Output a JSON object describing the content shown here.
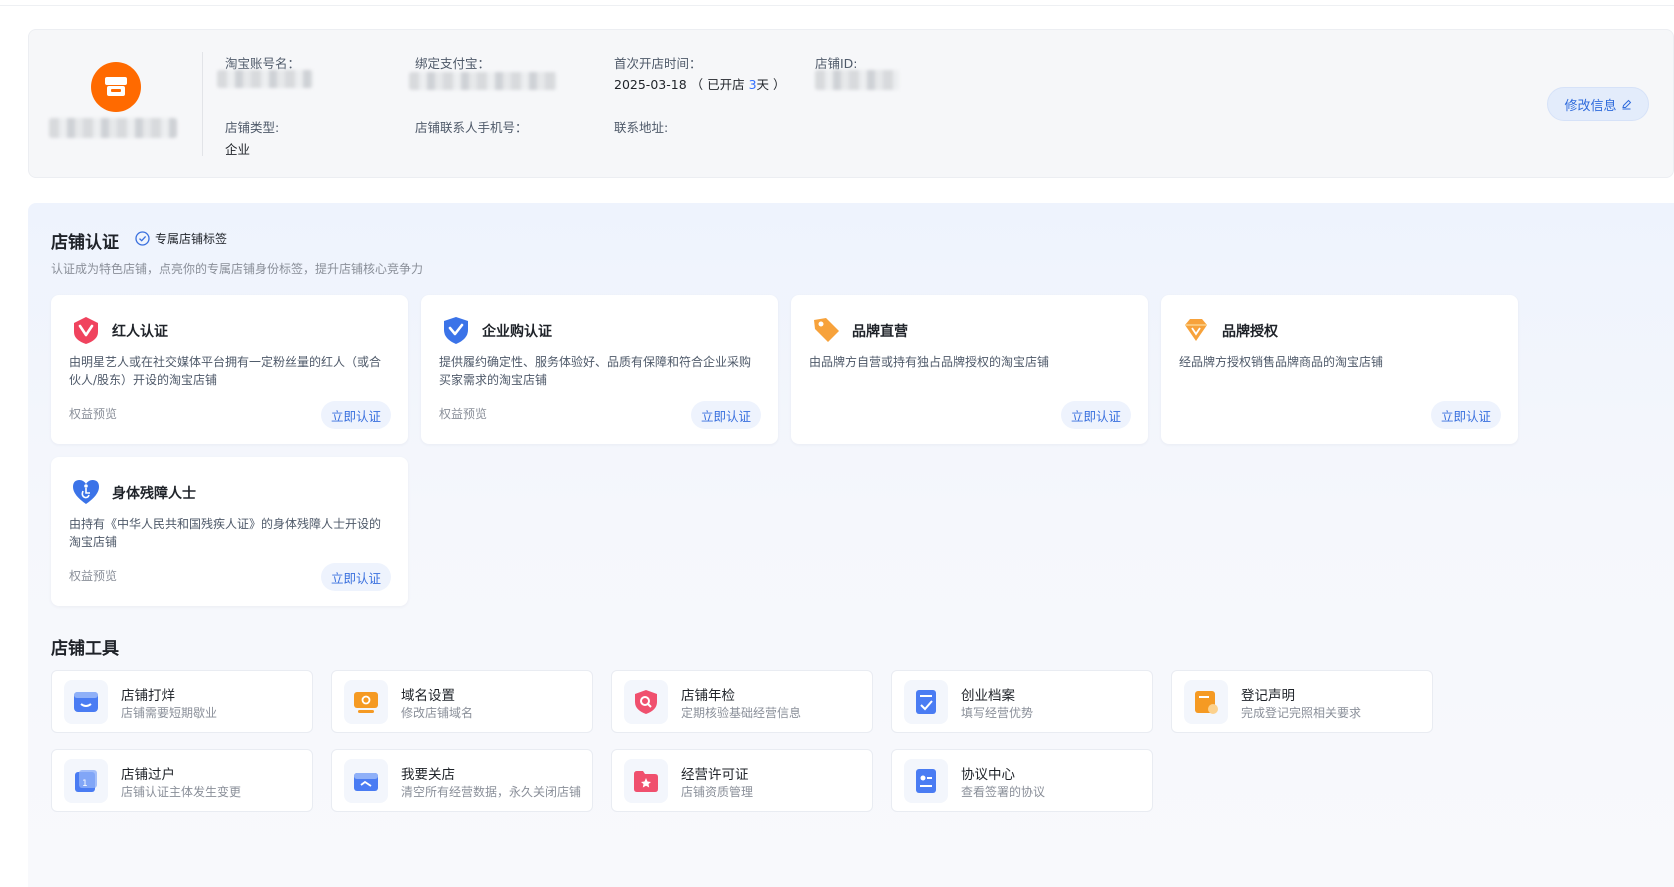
{
  "profile": {
    "account_label": "淘宝账号名：",
    "alipay_label": "绑定支付宝：",
    "open_time_label": "首次开店时间：",
    "open_date": "2025-03-18",
    "open_days_prefix": "（ 已开店 ",
    "open_days": "3",
    "open_days_suffix": "天 ）",
    "shop_id_label": "店铺ID:",
    "shop_type_label": "店铺类型:",
    "shop_type": "企业",
    "phone_label": "店铺联系人手机号：",
    "address_label": "联系地址:",
    "edit_button": "修改信息"
  },
  "certification": {
    "title": "店铺认证",
    "tag": "专属店铺标签",
    "subtitle": "认证成为特色店铺，点亮你的专属店铺身份标签，提升店铺核心竞争力",
    "cards": [
      {
        "title": "红人认证",
        "icon": "red-heart-badge-icon",
        "desc": "由明星艺人或在社交媒体平台拥有一定粉丝量的红人（或合伙人/股东）开设的淘宝店铺",
        "preview": "权益预览",
        "button": "立即认证"
      },
      {
        "title": "企业购认证",
        "icon": "blue-shield-check-icon",
        "desc": "提供履约确定性、服务体验好、品质有保障和符合企业采购买家需求的淘宝店铺",
        "preview": "权益预览",
        "button": "立即认证"
      },
      {
        "title": "品牌直营",
        "icon": "orange-tag-icon",
        "desc": "由品牌方自营或持有独占品牌授权的淘宝店铺",
        "preview": "",
        "button": "立即认证"
      },
      {
        "title": "品牌授权",
        "icon": "orange-diamond-icon",
        "desc": "经品牌方授权销售品牌商品的淘宝店铺",
        "preview": "",
        "button": "立即认证"
      },
      {
        "title": "身体残障人士",
        "icon": "blue-heart-accessibility-icon",
        "desc": "由持有《中华人民共和国残疾人证》的身体残障人士开设的淘宝店铺",
        "preview": "权益预览",
        "button": "立即认证"
      }
    ]
  },
  "tools": {
    "title": "店铺工具",
    "items": [
      {
        "name": "店铺打烊",
        "desc": "店铺需要短期歇业",
        "icon": "shop-closed-icon",
        "color": "#4a7cf3"
      },
      {
        "name": "域名设置",
        "desc": "修改店铺域名",
        "icon": "domain-settings-icon",
        "color": "#f59a23"
      },
      {
        "name": "店铺年检",
        "desc": "定期核验基础经营信息",
        "icon": "annual-inspection-icon",
        "color": "#f0506e"
      },
      {
        "name": "创业档案",
        "desc": "填写经营优势",
        "icon": "startup-archive-icon",
        "color": "#4a7cf3"
      },
      {
        "name": "登记声明",
        "desc": "完成登记完照相关要求",
        "icon": "registration-statement-icon",
        "color": "#f59a23"
      },
      {
        "name": "店铺过户",
        "desc": "店铺认证主体发生变更",
        "icon": "shop-transfer-icon",
        "color": "#4a7cf3"
      },
      {
        "name": "我要关店",
        "desc": "清空所有经营数据，永久关闭店铺",
        "icon": "close-shop-icon",
        "color": "#4a7cf3"
      },
      {
        "name": "经营许可证",
        "desc": "店铺资质管理",
        "icon": "business-license-icon",
        "color": "#f0506e"
      },
      {
        "name": "协议中心",
        "desc": "查看签署的协议",
        "icon": "agreement-center-icon",
        "color": "#4a7cf3"
      }
    ]
  }
}
